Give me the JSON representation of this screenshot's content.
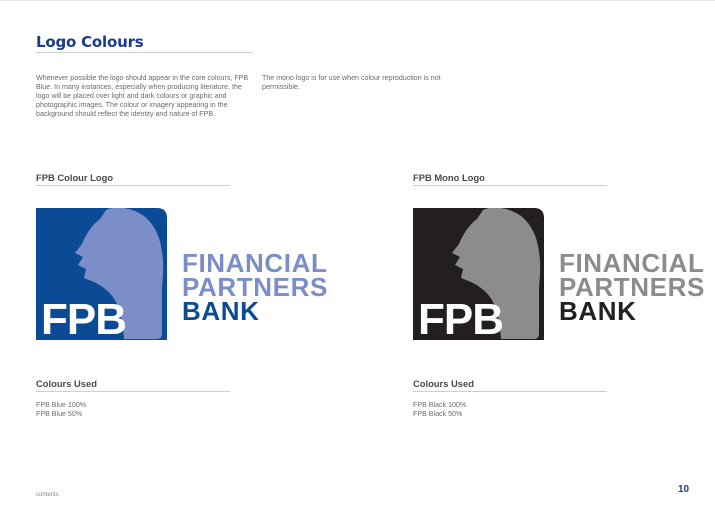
{
  "page": {
    "title": "Logo Colours",
    "intro_left": "Whenever possible the logo should appear in the core colours, FPB Blue. In many instances, especially when producing literature, the logo will be placed over light and dark colours or graphic and photographic images. The colour or imagery appearing in the background should reflect the identity and nature of FPB.",
    "intro_right": "The mono logo is for use when colour reproduction is not permissible.",
    "footer_link": "contents",
    "page_number": "10"
  },
  "colour_logo": {
    "heading": "FPB Colour Logo",
    "monogram": "FPB",
    "wordmark": [
      "FINANCIAL",
      "PARTNERS",
      "BANK"
    ],
    "colours_heading": "Colours Used",
    "colours": [
      "FPB Blue 100%",
      "FPB Blue 50%"
    ],
    "palette": {
      "box": "#0b4a95",
      "lion": "#7b8ec8",
      "monogram": "#ffffff",
      "wordmark_light": "#7b8ec8",
      "wordmark_dark": "#0b4a95"
    }
  },
  "mono_logo": {
    "heading": "FPB Mono Logo",
    "monogram": "FPB",
    "wordmark": [
      "FINANCIAL",
      "PARTNERS",
      "BANK"
    ],
    "colours_heading": "Colours Used",
    "colours": [
      "FPB Black 100%",
      "FPB Black 50%"
    ],
    "palette": {
      "box": "#231f20",
      "lion": "#8c8c8c",
      "monogram": "#ffffff",
      "wordmark_light": "#8c8c8c",
      "wordmark_dark": "#231f20"
    }
  }
}
